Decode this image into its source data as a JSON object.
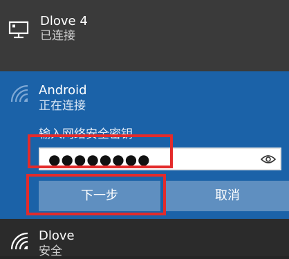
{
  "networks": [
    {
      "name": "Dlove 4",
      "status": "已连接",
      "icon": "ethernet-monitor-icon"
    },
    {
      "name": "Android",
      "status": "正在连接",
      "icon": "wifi-icon"
    },
    {
      "name": "Dlove",
      "status": "安全",
      "icon": "wifi-icon"
    }
  ],
  "connect_form": {
    "password_label": "输入网络安全密钥",
    "password_value": "●●●●●●●●",
    "reveal_icon": "eye-icon",
    "next_label": "下一步",
    "cancel_label": "取消"
  },
  "colors": {
    "selected_background": "#1b62a8",
    "button_background": "#5f8fc0",
    "highlight_border": "#e32b2b"
  }
}
